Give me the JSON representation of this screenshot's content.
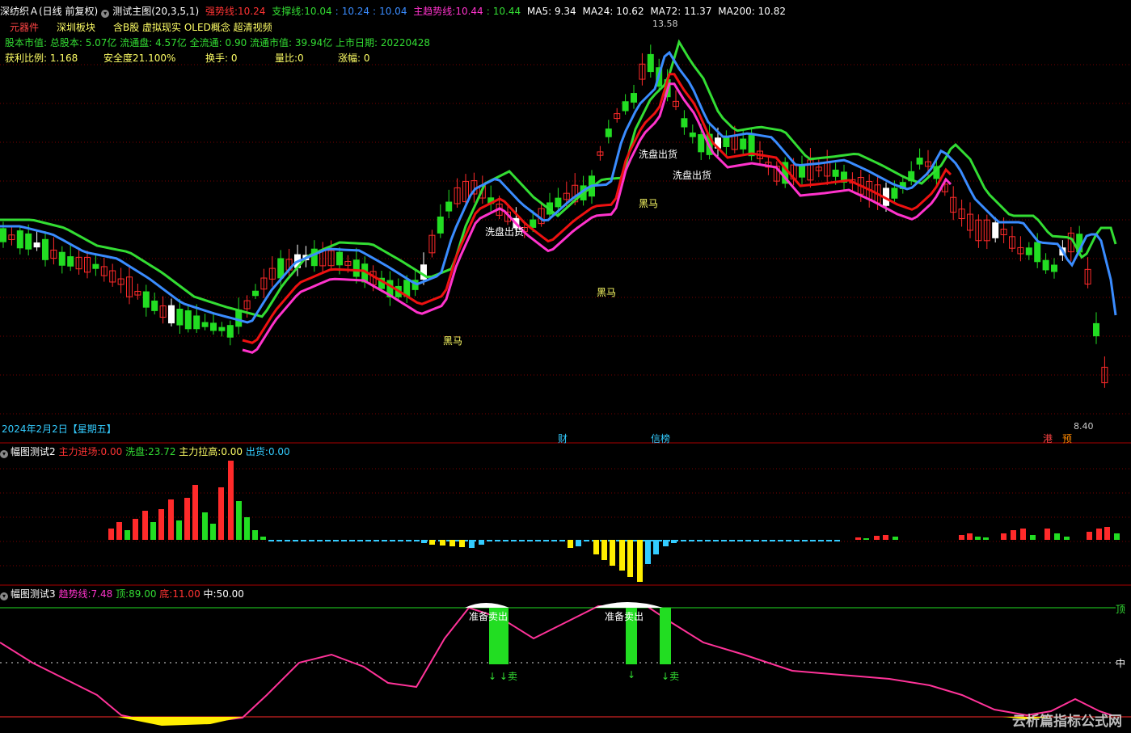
{
  "main_header": {
    "stock": "深纺织Ａ(日线 前复权)",
    "indicator": "测试主图(20,3,5,1)",
    "strong_label": "强势线:",
    "strong_val": "10.24",
    "support_label": "支撑线:",
    "support_val1": "10.04",
    "support_sep": ":",
    "support_val2": "10.24",
    "support_sep2": ":",
    "support_val3": "10.04",
    "trend_label": "主趋势线:",
    "trend_val1": "10.44",
    "trend_sep": ":",
    "trend_val2": "10.44",
    "ma5": "MA5: 9.34",
    "ma24": "MA24: 10.62",
    "ma72": "MA72: 11.37",
    "ma200": "MA200: 10.82"
  },
  "info": {
    "tag1": "元器件",
    "tag2": "深圳板块",
    "tag3": "含B股 虚拟现实 OLED概念 超清视频",
    "line2": "股本市值: 总股本: 5.07亿 流通盘: 4.57亿 全流通: 0.90 流通市值: 39.94亿 上市日期: 20220428",
    "profit_label": "获利比例:",
    "profit_val": "1.168",
    "safety": "安全度21.100%",
    "turnover_label": "换手:",
    "turnover_val": "0",
    "volratio_label": "量比:0",
    "change_label": "涨幅:",
    "change_val": "0"
  },
  "annotations": {
    "high_price": "13.58",
    "low_price": "8.40",
    "wash1": "洗盘出货",
    "wash2": "洗盘出货",
    "wash3": "洗盘出货",
    "dark_horse": "黑马",
    "date": "2024年2月2日【星期五】",
    "event_cai": "财",
    "event_xin": "信榜",
    "event_gang": "港",
    "event_yu": "预"
  },
  "panel2": {
    "title": "幅图测试2",
    "main_in_label": "主力进场:",
    "main_in_val": "0.00",
    "wash_label": "洗盘:",
    "wash_val": "23.72",
    "pull_label": "主力拉高:",
    "pull_val": "0.00",
    "out_label": "出货:",
    "out_val": "0.00"
  },
  "panel3": {
    "title": "幅图测试3",
    "trend_label": "趋势线:",
    "trend_val": "7.48",
    "top_label": "顶:",
    "top_val": "89.00",
    "bottom_label": "底:",
    "bottom_val": "11.00",
    "mid_label": "中:",
    "mid_val": "50.00",
    "right_top": "顶",
    "right_mid": "中",
    "prep_sell": "准备卖出",
    "sell": "卖",
    "watermark": "云析篇指标公式网"
  },
  "colors": {
    "up": "#ff2a2a",
    "down": "#22dd22",
    "doji": "#ffffff",
    "ma_red": "#ee1111",
    "ma_magenta": "#ff33cc",
    "ma_blue": "#3a8cff",
    "ma_green": "#33dd33",
    "grid": "#7a0000",
    "cyan": "#33ccff",
    "yellow": "#ffee00"
  }
}
